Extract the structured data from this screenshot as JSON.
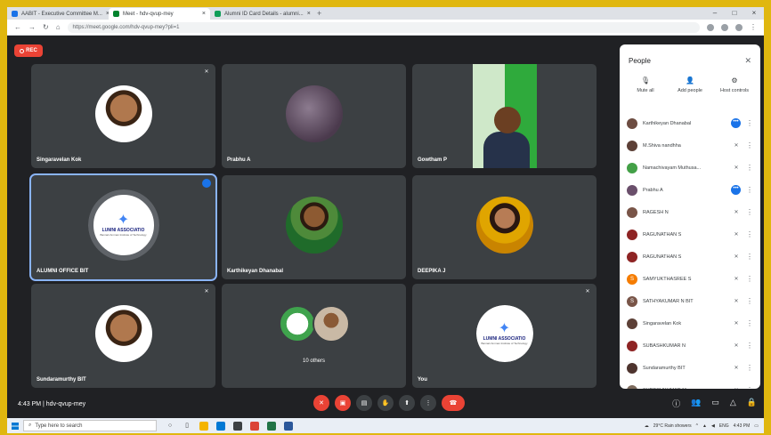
{
  "browser": {
    "tabs": [
      {
        "title": "AABIT - Executive Committee M..."
      },
      {
        "title": "Meet - hdv-qvup-mey"
      },
      {
        "title": "Alumni ID Card Details - alumni..."
      }
    ],
    "new_tab": "+",
    "url": "https://meet.google.com/hdv-qvup-mey?pli=1",
    "window_controls": [
      "–",
      "□",
      "×"
    ]
  },
  "recording": {
    "label": "REC"
  },
  "tiles": [
    {
      "name": "Singaravelan Kok"
    },
    {
      "name": "Prabhu A"
    },
    {
      "name": "Gowtham P"
    },
    {
      "name": "ALUMNI OFFICE BIT",
      "logo_text": "LUMNI ASSOCIATIO",
      "logo_sub": "Bannari Amman Institute of Technology"
    },
    {
      "name": "Karthikeyan Dhanabal"
    },
    {
      "name": "DEEPIKA J"
    },
    {
      "name": "Sundaramurthy BIT"
    },
    {
      "name": "",
      "others_label": "10 others"
    },
    {
      "name": "You",
      "logo_text": "LUMNI ASSOCIATIO",
      "logo_sub": "Bannari Amman Institute of Technology"
    }
  ],
  "people_panel": {
    "title": "People",
    "actions": [
      {
        "label": "Mute all",
        "icon": "mic-off-icon"
      },
      {
        "label": "Add people",
        "icon": "add-person-icon"
      },
      {
        "label": "Host controls",
        "icon": "host-controls-icon"
      }
    ],
    "participants": [
      {
        "name": "Karthikeyan Dhanabal",
        "color": "#6d4c41",
        "status": "speaking"
      },
      {
        "name": "M.Shiva nandhha",
        "color": "#5d4037",
        "status": "muted"
      },
      {
        "name": "Namachivayam Muthusa...",
        "color": "#43a047",
        "status": "muted"
      },
      {
        "name": "Prabhu A",
        "color": "#6a4f6b",
        "status": "speaking"
      },
      {
        "name": "RAGESH N",
        "color": "#795548",
        "status": "muted"
      },
      {
        "name": "RAGUNATHAN S",
        "color": "#8e2424",
        "status": "muted"
      },
      {
        "name": "RAGUNATHAN S",
        "color": "#8e2424",
        "status": "muted"
      },
      {
        "name": "SAMYUKTHASREE S",
        "color": "#f57c00",
        "initial": "S",
        "status": "muted"
      },
      {
        "name": "SATHYAKUMAR N BIT",
        "color": "#795548",
        "initial": "S",
        "status": "muted"
      },
      {
        "name": "Singaravelan Kok",
        "color": "#5d4037",
        "status": "muted"
      },
      {
        "name": "SUBASHKUMAR N",
        "color": "#8e2424",
        "status": "muted"
      },
      {
        "name": "Sundaramurthy BIT",
        "color": "#4e342e",
        "status": "muted"
      },
      {
        "name": "SURESHKUMAR M",
        "color": "#7d6b5d",
        "status": "muted"
      }
    ]
  },
  "bottom_bar": {
    "meeting_info": "4:43 PM  |  hdv-qvup-mey",
    "controls": [
      "mic-off-icon",
      "camera-off-icon",
      "captions-icon",
      "raise-hand-icon",
      "present-icon",
      "more-options-icon",
      "end-call-icon"
    ],
    "right_icons": [
      "info-icon",
      "people-icon",
      "chat-icon",
      "activities-icon",
      "lock-icon"
    ]
  },
  "taskbar": {
    "search_placeholder": "Type here to search",
    "weather": "29°C  Rain showers",
    "lang": "ENG",
    "time": "4:43 PM"
  }
}
